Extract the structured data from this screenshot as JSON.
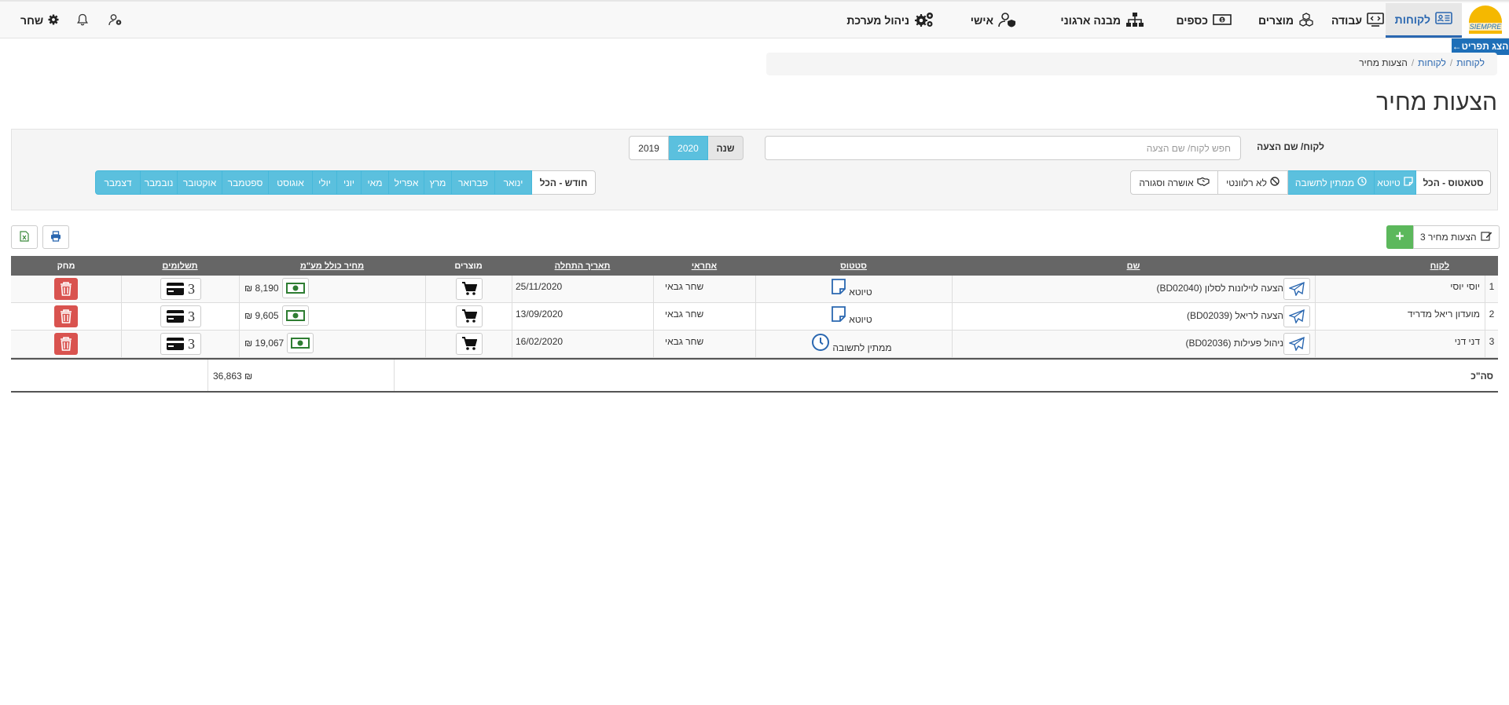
{
  "nav": {
    "logo_text": "SIEMPRE",
    "items": [
      {
        "label": "לקוחות",
        "icon": "id-card-icon",
        "active": true
      },
      {
        "label": "עבודה",
        "icon": "monitor-code-icon"
      },
      {
        "label": "מוצרים",
        "icon": "cubes-icon"
      },
      {
        "label": "כספים",
        "icon": "banknote-icon"
      },
      {
        "label": "מבנה ארגוני",
        "icon": "org-chart-icon"
      },
      {
        "label": "אישי",
        "icon": "user-shield-icon"
      },
      {
        "label": "ניהול מערכת",
        "icon": "gears-icon"
      }
    ],
    "user_name": "שחר",
    "menu_toggle": "הצג תפריט←"
  },
  "breadcrumb": [
    "לקוחות",
    "לקוחות",
    "הצעות מחיר"
  ],
  "title": "הצעות מחיר",
  "filters": {
    "search_label": "לקוח/ שם הצעה",
    "search_placeholder": "חפש לקוח/ שם הצעה",
    "year_label": "שנה",
    "years": [
      "2020",
      "2019"
    ],
    "selected_year": "2020",
    "status_all": "סטאטוס - הכל",
    "statuses": [
      {
        "label": "טיוטא",
        "icon": "sticky-note-icon",
        "on": true
      },
      {
        "label": "ממתין לתשובה",
        "icon": "clock-icon",
        "on": true
      },
      {
        "label": "לא רלוונטי",
        "icon": "ban-icon",
        "on": false
      },
      {
        "label": "אושרה וסגורה",
        "icon": "handshake-icon",
        "on": false
      }
    ],
    "month_all": "חודש - הכל",
    "months": [
      "ינואר",
      "פברואר",
      "מרץ",
      "אפריל",
      "מאי",
      "יוני",
      "יולי",
      "אוגוסט",
      "ספטמבר",
      "אוקטובר",
      "נובמבר",
      "דצמבר"
    ]
  },
  "toolbar": {
    "quotes_label": "הצעות מחיר 3",
    "add_label": "+"
  },
  "table": {
    "headers": [
      "לקוח",
      "שם",
      "סטטוס",
      "אחראי",
      "תאריך התחלה",
      "מוצרים",
      "מחיר כולל מע\"מ",
      "תשלומים",
      "מחק"
    ],
    "rows": [
      {
        "num": "1",
        "customer": "יוסי יוסי",
        "name": "הצעה לוילונות לסלון (BD02040)",
        "status": "טיוטא",
        "status_icon": "sticky-note-icon",
        "responsible": "שחר גבאי",
        "date": "25/11/2020",
        "price": "₪ 8,190",
        "payments": "3"
      },
      {
        "num": "2",
        "customer": "מועדון ריאל מדריד",
        "name": "הצעה לריאל (BD02039)",
        "status": "טיוטא",
        "status_icon": "sticky-note-icon",
        "responsible": "שחר גבאי",
        "date": "13/09/2020",
        "price": "₪ 9,605",
        "payments": "3"
      },
      {
        "num": "3",
        "customer": "דני דני",
        "name": "ניהול פעילות (BD02036)",
        "status": "ממתין לתשובה",
        "status_icon": "clock-icon",
        "responsible": "שחר גבאי",
        "date": "16/02/2020",
        "price": "₪ 19,067",
        "payments": "3"
      }
    ],
    "total_label": "סה\"כ",
    "total_value": "₪ 36,863"
  },
  "colors": {
    "accent": "#2a67b0",
    "info": "#5bc0de",
    "success": "#5cb85c",
    "danger": "#d9534f",
    "header": "#666666"
  }
}
